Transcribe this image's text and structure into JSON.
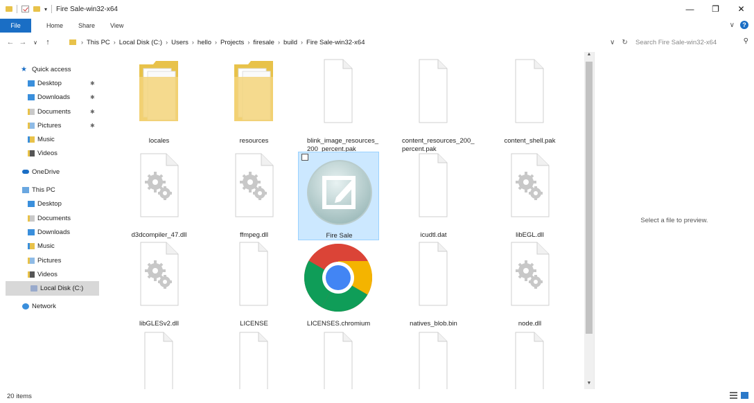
{
  "window": {
    "title": "Fire Sale-win32-x64"
  },
  "ribbon": {
    "tabs": [
      "File",
      "Home",
      "Share",
      "View"
    ]
  },
  "address": {
    "crumbs": [
      "This PC",
      "Local Disk (C:)",
      "Users",
      "hello",
      "Projects",
      "firesale",
      "build",
      "Fire Sale-win32-x64"
    ]
  },
  "search": {
    "placeholder": "Search Fire Sale-win32-x64"
  },
  "sidebar": {
    "items": [
      {
        "label": "Quick access",
        "icon": "star-icon"
      },
      {
        "label": "Desktop",
        "icon": "desktop-folder-icon",
        "pinned": true
      },
      {
        "label": "Downloads",
        "icon": "downloads-folder-icon",
        "pinned": true
      },
      {
        "label": "Documents",
        "icon": "documents-folder-icon",
        "pinned": true
      },
      {
        "label": "Pictures",
        "icon": "pictures-folder-icon",
        "pinned": true
      },
      {
        "label": "Music",
        "icon": "music-folder-icon"
      },
      {
        "label": "Videos",
        "icon": "videos-folder-icon"
      },
      {
        "label": "OneDrive",
        "icon": "onedrive-cloud-icon"
      },
      {
        "label": "This PC",
        "icon": "computer-icon"
      },
      {
        "label": "Desktop",
        "icon": "desktop-folder-icon"
      },
      {
        "label": "Documents",
        "icon": "documents-folder-icon"
      },
      {
        "label": "Downloads",
        "icon": "downloads-folder-icon"
      },
      {
        "label": "Music",
        "icon": "music-folder-icon"
      },
      {
        "label": "Pictures",
        "icon": "pictures-folder-icon"
      },
      {
        "label": "Videos",
        "icon": "videos-folder-icon"
      },
      {
        "label": "Local Disk (C:)",
        "icon": "disk-drive-icon",
        "selected": true
      },
      {
        "label": "Network",
        "icon": "network-icon"
      }
    ]
  },
  "files": [
    {
      "name": "locales",
      "type": "folder"
    },
    {
      "name": "resources",
      "type": "folder"
    },
    {
      "name": "blink_image_resources_\n200_percent.pak",
      "type": "file"
    },
    {
      "name": "content_resources_200_\npercent.pak",
      "type": "file"
    },
    {
      "name": "content_shell.pak",
      "type": "file"
    },
    {
      "name": "d3dcompiler_47.dll",
      "type": "dll"
    },
    {
      "name": "ffmpeg.dll",
      "type": "dll"
    },
    {
      "name": "Fire Sale",
      "type": "app",
      "selected": true
    },
    {
      "name": "icudtl.dat",
      "type": "file"
    },
    {
      "name": "libEGL.dll",
      "type": "dll"
    },
    {
      "name": "libGLESv2.dll",
      "type": "dll"
    },
    {
      "name": "LICENSE",
      "type": "file"
    },
    {
      "name": "LICENSES.chromium",
      "type": "chrome"
    },
    {
      "name": "natives_blob.bin",
      "type": "file"
    },
    {
      "name": "node.dll",
      "type": "dll"
    },
    {
      "name": "",
      "type": "file"
    },
    {
      "name": "",
      "type": "file"
    },
    {
      "name": "",
      "type": "file"
    },
    {
      "name": "",
      "type": "file"
    },
    {
      "name": "",
      "type": "file"
    }
  ],
  "preview": {
    "text": "Select a file to preview."
  },
  "status": {
    "count": "20 items"
  },
  "colors": {
    "accent": "#1a6ec5",
    "selection": "#cce8ff",
    "folder": "#e8c24a"
  }
}
